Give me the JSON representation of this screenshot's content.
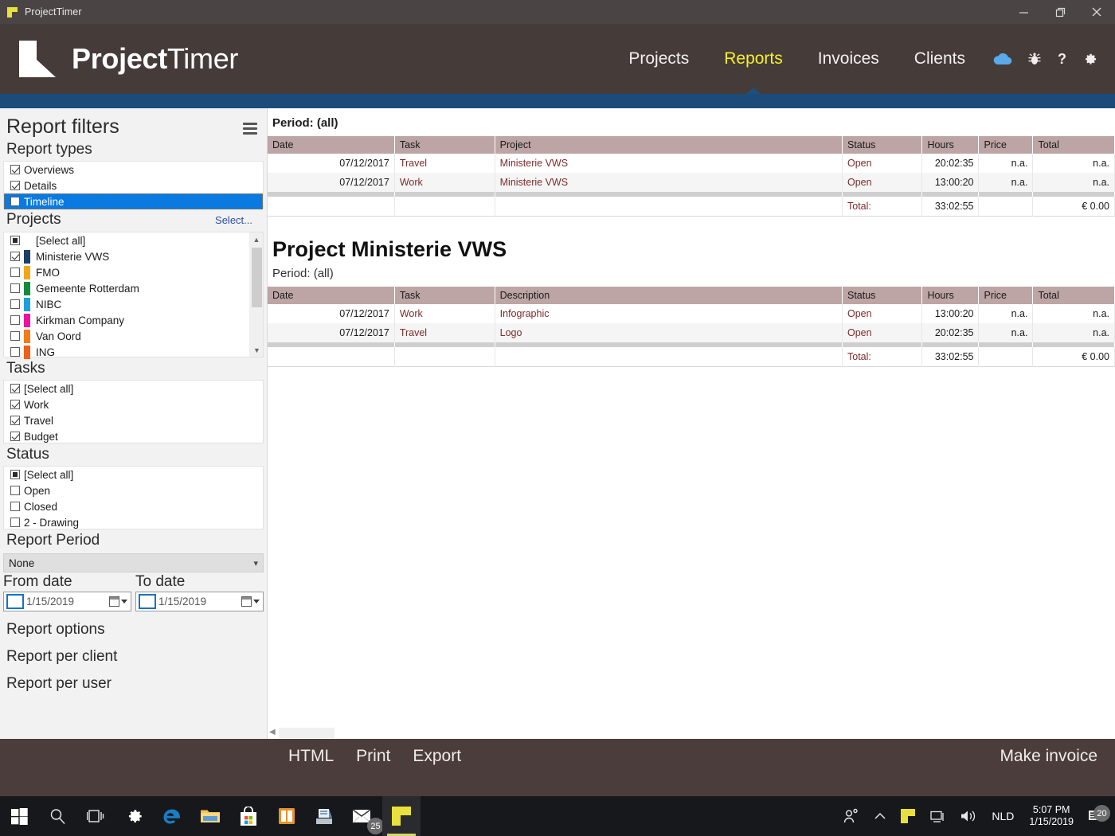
{
  "window": {
    "title": "ProjectTimer",
    "minimize_label": "Minimize",
    "restore_label": "Restore",
    "close_label": "Close"
  },
  "brand": {
    "bold": "Project",
    "light": "Timer"
  },
  "nav": {
    "items": [
      {
        "label": "Projects",
        "active": false
      },
      {
        "label": "Reports",
        "active": true
      },
      {
        "label": "Invoices",
        "active": false
      },
      {
        "label": "Clients",
        "active": false
      }
    ],
    "icons": [
      "cloud-icon",
      "bug-icon",
      "help-icon",
      "gear-icon"
    ],
    "active_color": "#f6f02a",
    "accent_bar_color": "#1c4b79"
  },
  "sidebar": {
    "title": "Report filters",
    "menu_icon": "hamburger-icon",
    "report_types": {
      "heading": "Report types",
      "items": [
        {
          "label": "Overviews",
          "checked": true,
          "selected": false
        },
        {
          "label": "Details",
          "checked": true,
          "selected": false
        },
        {
          "label": "Timeline",
          "checked": false,
          "selected": true
        }
      ]
    },
    "projects": {
      "heading": "Projects",
      "select_link": "Select...",
      "items": [
        {
          "label": "[Select all]",
          "state": "partial",
          "color": ""
        },
        {
          "label": "Ministerie VWS",
          "state": "checked",
          "color": "#1b3f66"
        },
        {
          "label": "FMO",
          "state": "unchecked",
          "color": "#f0a71e"
        },
        {
          "label": "Gemeente Rotterdam",
          "state": "unchecked",
          "color": "#138b3d"
        },
        {
          "label": "NIBC",
          "state": "unchecked",
          "color": "#20a0db"
        },
        {
          "label": "Kirkman Company",
          "state": "unchecked",
          "color": "#ee12a0"
        },
        {
          "label": "Van Oord",
          "state": "unchecked",
          "color": "#f07d1a"
        },
        {
          "label": "ING",
          "state": "unchecked",
          "color": "#f0601a"
        }
      ]
    },
    "tasks": {
      "heading": "Tasks",
      "items": [
        {
          "label": "[Select all]",
          "state": "checked"
        },
        {
          "label": "Work",
          "state": "checked"
        },
        {
          "label": "Travel",
          "state": "checked"
        },
        {
          "label": "Budget",
          "state": "checked"
        }
      ]
    },
    "status": {
      "heading": "Status",
      "items": [
        {
          "label": "[Select all]",
          "state": "partial"
        },
        {
          "label": "Open",
          "state": "unchecked"
        },
        {
          "label": "Closed",
          "state": "unchecked"
        },
        {
          "label": "2 - Drawing",
          "state": "unchecked"
        }
      ]
    },
    "report_period": {
      "heading": "Report Period",
      "selected": "None",
      "options": [
        "None"
      ]
    },
    "from_date": {
      "label": "From date",
      "value": "1/15/2019"
    },
    "to_date": {
      "label": "To date",
      "value": "1/15/2019"
    },
    "options": [
      "Report options",
      "Report per client",
      "Report per user"
    ]
  },
  "main": {
    "overview": {
      "period": "Period: (all)",
      "columns": [
        "Date",
        "Task",
        "Project",
        "Status",
        "Hours",
        "Price",
        "Total"
      ],
      "rows": [
        {
          "date": "07/12/2017",
          "task": "Travel",
          "project": "Ministerie VWS",
          "status": "Open",
          "hours": "20:02:35",
          "price": "n.a.",
          "total": "n.a."
        },
        {
          "date": "07/12/2017",
          "task": "Work",
          "project": "Ministerie VWS",
          "status": "Open",
          "hours": "13:00:20",
          "price": "n.a.",
          "total": "n.a."
        }
      ],
      "total_label": "Total:",
      "total_hours": "33:02:55",
      "total_price": "",
      "total_amount": "€ 0.00"
    },
    "detail": {
      "title": "Project Ministerie VWS",
      "period": "Period: (all)",
      "columns": [
        "Date",
        "Task",
        "Description",
        "Status",
        "Hours",
        "Price",
        "Total"
      ],
      "rows": [
        {
          "date": "07/12/2017",
          "task": "Work",
          "description": "Infographic",
          "status": "Open",
          "hours": "13:00:20",
          "price": "n.a.",
          "total": "n.a."
        },
        {
          "date": "07/12/2017",
          "task": "Travel",
          "description": "Logo",
          "status": "Open",
          "hours": "20:02:35",
          "price": "n.a.",
          "total": "n.a."
        }
      ],
      "total_label": "Total:",
      "total_hours": "33:02:55",
      "total_price": "",
      "total_amount": "€ 0.00"
    }
  },
  "bottom_toolbar": {
    "actions": [
      "HTML",
      "Print",
      "Export"
    ],
    "make_invoice": "Make invoice"
  },
  "taskbar": {
    "items": [
      "start-icon",
      "search-icon",
      "task-view-icon",
      "settings-icon",
      "edge-icon",
      "file-explorer-icon",
      "store-icon",
      "office-icon",
      "scanner-icon",
      "mail-icon",
      "projecttimer-icon"
    ],
    "mail_badge": "25",
    "tray": [
      "people-icon",
      "show-hidden-icons-icon",
      "projecttimer-tray-icon",
      "network-icon",
      "volume-icon"
    ],
    "language": "NLD",
    "time": "5:07 PM",
    "date": "1/15/2019",
    "notification_count": "20"
  }
}
